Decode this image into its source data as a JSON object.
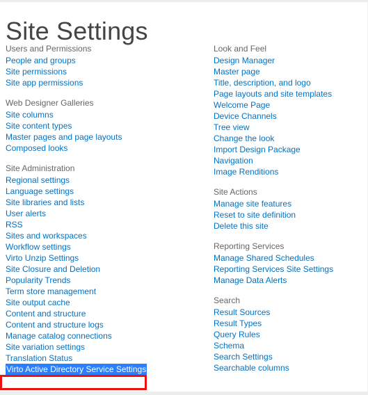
{
  "page": {
    "title": "Site Settings"
  },
  "columns": {
    "left": [
      {
        "heading": "Users and Permissions",
        "links": [
          "People and groups",
          "Site permissions",
          "Site app permissions"
        ]
      },
      {
        "heading": "Web Designer Galleries",
        "links": [
          "Site columns",
          "Site content types",
          "Master pages and page layouts",
          "Composed looks"
        ]
      },
      {
        "heading": "Site Administration",
        "links": [
          "Regional settings",
          "Language settings",
          "Site libraries and lists",
          "User alerts",
          "RSS",
          "Sites and workspaces",
          "Workflow settings",
          "Virto Unzip Settings",
          "Site Closure and Deletion",
          "Popularity Trends",
          "Term store management",
          "Site output cache",
          "Content and structure",
          "Content and structure logs",
          "Manage catalog connections",
          "Site variation settings",
          "Translation Status",
          "Virto Active Directory Service Settings"
        ],
        "selected_link": "Virto Active Directory Service Settings"
      }
    ],
    "right": [
      {
        "heading": "Look and Feel",
        "links": [
          "Design Manager",
          "Master page",
          "Title, description, and logo",
          "Page layouts and site templates",
          "Welcome Page",
          "Device Channels",
          "Tree view",
          "Change the look",
          "Import Design Package",
          "Navigation",
          "Image Renditions"
        ]
      },
      {
        "heading": "Site Actions",
        "links": [
          "Manage site features",
          "Reset to site definition",
          "Delete this site"
        ]
      },
      {
        "heading": "Reporting Services",
        "links": [
          "Manage Shared Schedules",
          "Reporting Services Site Settings",
          "Manage Data Alerts"
        ]
      },
      {
        "heading": "Search",
        "links": [
          "Result Sources",
          "Result Types",
          "Query Rules",
          "Schema",
          "Search Settings",
          "Searchable columns"
        ]
      }
    ]
  },
  "annotation": {
    "target": "Virto Active Directory Service Settings",
    "box_color": "#ee1111"
  },
  "colors": {
    "link": "#0072c6",
    "heading": "#666666",
    "title": "#444444",
    "selection_background": "#2a7fff",
    "selection_text": "#ffffff"
  }
}
